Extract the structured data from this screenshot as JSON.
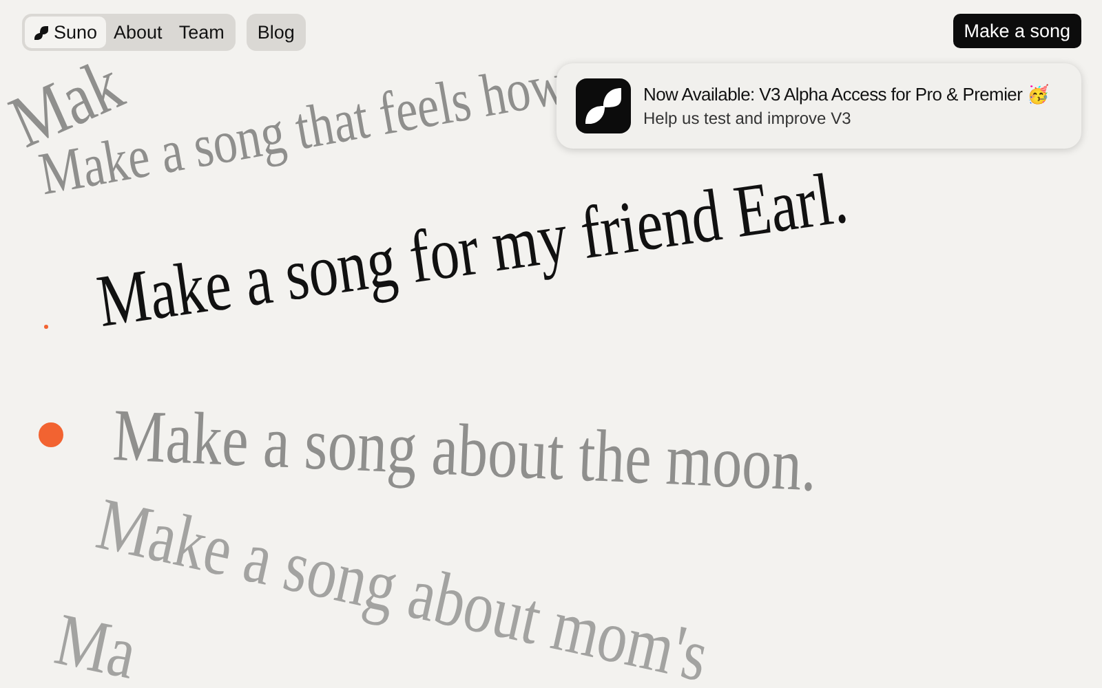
{
  "nav": {
    "items": [
      {
        "label": "Suno",
        "selected": true
      },
      {
        "label": "About",
        "selected": false
      },
      {
        "label": "Team",
        "selected": false
      }
    ],
    "blog": "Blog",
    "cta": "Make a song"
  },
  "notice": {
    "title": "Now Available: V3 Alpha Access for Pro & Premier 🥳",
    "subtitle": "Help us test and improve V3"
  },
  "prompts": [
    {
      "text": "Mak",
      "selected": false
    },
    {
      "text": "Make a song that feels how",
      "selected": false
    },
    {
      "text": "Make a song for my friend Earl.",
      "selected": true
    },
    {
      "text": "Make a song about the moon.",
      "selected": false
    },
    {
      "text": "Make a song about mom's",
      "selected": false
    },
    {
      "text": "Ma",
      "selected": false
    }
  ]
}
